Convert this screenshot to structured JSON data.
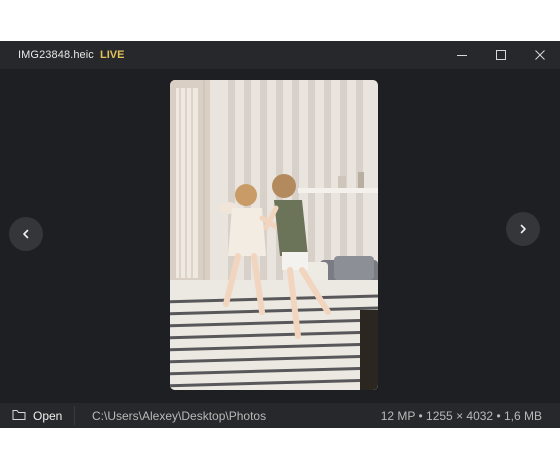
{
  "window": {
    "title": "IMG23848.heic",
    "live_badge": "LIVE"
  },
  "controls": {
    "minimize_icon": "minimize-icon",
    "maximize_icon": "maximize-icon",
    "close_icon": "close-icon"
  },
  "viewer": {
    "prev_icon": "chevron-left-icon",
    "next_icon": "chevron-right-icon",
    "photo_alt": "Two children jumping on a bed"
  },
  "statusbar": {
    "open_label": "Open",
    "open_icon": "folder-icon",
    "path": "C:\\Users\\Alexey\\Desktop\\Photos",
    "info": "12 MP • 1255 × 4032 • 1,6 MB"
  },
  "colors": {
    "titlebar": "#27282b",
    "viewer_bg": "#1e1f22",
    "live_accent": "#e0c25a"
  }
}
